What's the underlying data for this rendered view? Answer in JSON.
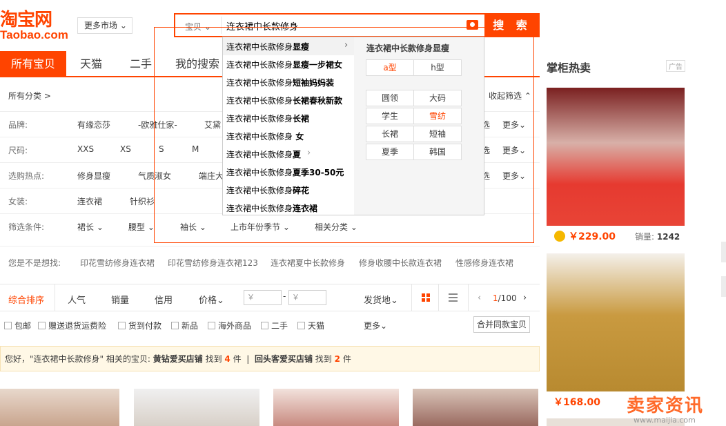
{
  "header": {
    "logo_cn": "淘宝网",
    "logo_en": "Taobao.com",
    "more_market": "更多市场",
    "search_type": "宝贝",
    "search_value": "连衣裙中长款修身",
    "search_button": "搜 索"
  },
  "tabs": [
    "所有宝贝",
    "天猫",
    "二手",
    "我的搜索"
  ],
  "right_panel": {
    "title": "掌柜热卖",
    "ad_label": "广告",
    "item1_price": "￥229.00",
    "item1_sales_label": "销量:",
    "item1_sales": "1242",
    "item2_price": "￥168.00"
  },
  "filters": {
    "all_category": "所有分类 >",
    "collapse": "收起筛选",
    "brand_label": "品牌:",
    "brands": [
      "有缘恋莎",
      "-欧雅仕家-",
      "艾黛"
    ],
    "size_label": "尺码:",
    "sizes": [
      "XXS",
      "XS",
      "S",
      "M"
    ],
    "hot_label": "选购热点:",
    "hot": [
      "修身显瘦",
      "气质淑女",
      "端庄大"
    ],
    "women_label": "女装:",
    "women": [
      "连衣裙",
      "针织衫"
    ],
    "cond_label": "筛选条件:",
    "conds": [
      "裙长",
      "腰型",
      "袖长",
      "上市年份季节",
      "相关分类"
    ],
    "more": "更多",
    "multi": "选"
  },
  "suggest": {
    "items": [
      {
        "prefix": "连衣裙中长款修身",
        "bold": "显瘦"
      },
      {
        "prefix": "连衣裙中长款修身",
        "bold": "显瘦一步裙女"
      },
      {
        "prefix": "连衣裙中长款修身",
        "bold": "短袖妈妈装"
      },
      {
        "prefix": "连衣裙中长款修身",
        "bold": "长裙春秋新款"
      },
      {
        "prefix": "连衣裙中长款修身",
        "bold": "长裙"
      },
      {
        "prefix": "连衣裙中长款修身",
        "bold": " 女"
      },
      {
        "prefix": "连衣裙中长款修身",
        "bold": "夏"
      },
      {
        "prefix": "连衣裙中长款修身",
        "bold": "夏季30-50元"
      },
      {
        "prefix": "连衣裙中长款修身",
        "bold": "碎花"
      },
      {
        "prefix": "连衣裙中长款修身",
        "bold": "连衣裙"
      }
    ],
    "right_title": "连衣裙中长款修身显瘦",
    "attrs_top": [
      "a型",
      "h型"
    ],
    "attrs": [
      "圆领",
      "大码",
      "学生",
      "雪纺",
      "长裙",
      "短袖",
      "夏季",
      "韩国"
    ]
  },
  "did_you_mean": {
    "label": "您是不是想找:",
    "items": [
      "印花雪纺修身连衣裙",
      "印花雪纺修身连衣裙123",
      "连衣裙夏中长款修身",
      "修身收腰中长款连衣裙",
      "性感修身连衣裙"
    ]
  },
  "sortbar": {
    "items": [
      "综合排序",
      "人气",
      "销量",
      "信用",
      "价格"
    ],
    "price_placeholder": "￥",
    "dash": "-",
    "ship_from": "发货地",
    "page_current": "1",
    "page_total": "/100"
  },
  "checks": [
    "包邮",
    "赠送退货运费险",
    "货到付款",
    "新品",
    "海外商品",
    "二手",
    "天猫"
  ],
  "checks_more": "更多",
  "merge": "合并同款宝贝",
  "notice": {
    "text1": "您好，\"连衣裙中长款修身\" 相关的宝贝:",
    "shop1": "黄钻爱买店铺",
    "find1": "找到",
    "count1": "4",
    "unit1": "件",
    "sep": "|",
    "shop2": "回头客爱买店铺",
    "find2": "找到",
    "count2": "2",
    "unit2": "件"
  },
  "watermark": {
    "title": "卖家资讯",
    "url": "www.maijia.com"
  }
}
